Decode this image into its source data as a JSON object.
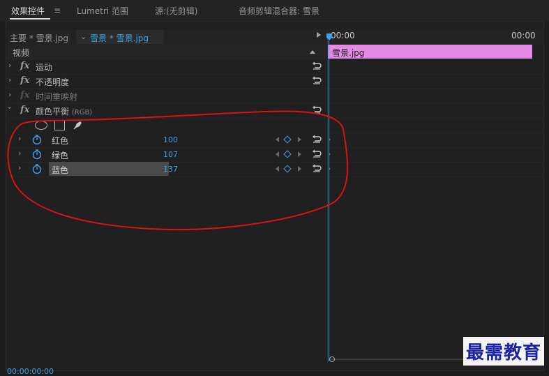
{
  "tabs": [
    {
      "label": "效果控件",
      "active": true
    },
    {
      "label": "Lumetri 范围",
      "active": false
    },
    {
      "label": "源:(无剪辑)",
      "active": false
    },
    {
      "label": "音频剪辑混合器: 雪景",
      "active": false
    }
  ],
  "menu_glyph": "≡",
  "breadcrumb": {
    "master": "主要 * 雪景.jpg",
    "clip": "雪景 * 雪景.jpg"
  },
  "timeline": {
    "start_time": "00:00",
    "end_time": "00:00",
    "clip_label": "雪景.jpg",
    "clip_color": "#e48ae4",
    "bottom_timecode": "00:00:00:00"
  },
  "section": {
    "label": "视频"
  },
  "effects": [
    {
      "label": "运动",
      "dim": false
    },
    {
      "label": "不透明度",
      "dim": false
    },
    {
      "label": "时间重映射",
      "dim": true
    }
  ],
  "color_balance": {
    "label": "颜色平衡",
    "sub": "(RGB)",
    "params": [
      {
        "label": "红色",
        "value": "100",
        "selected": false
      },
      {
        "label": "绿色",
        "value": "107",
        "selected": false
      },
      {
        "label": "蓝色",
        "value": "137",
        "selected": true
      }
    ]
  },
  "icons": {
    "fx": "fx",
    "chevron_right": "›",
    "chevron_down": "⌄"
  },
  "accent": "#3ea2e8",
  "watermark": "最需教育"
}
